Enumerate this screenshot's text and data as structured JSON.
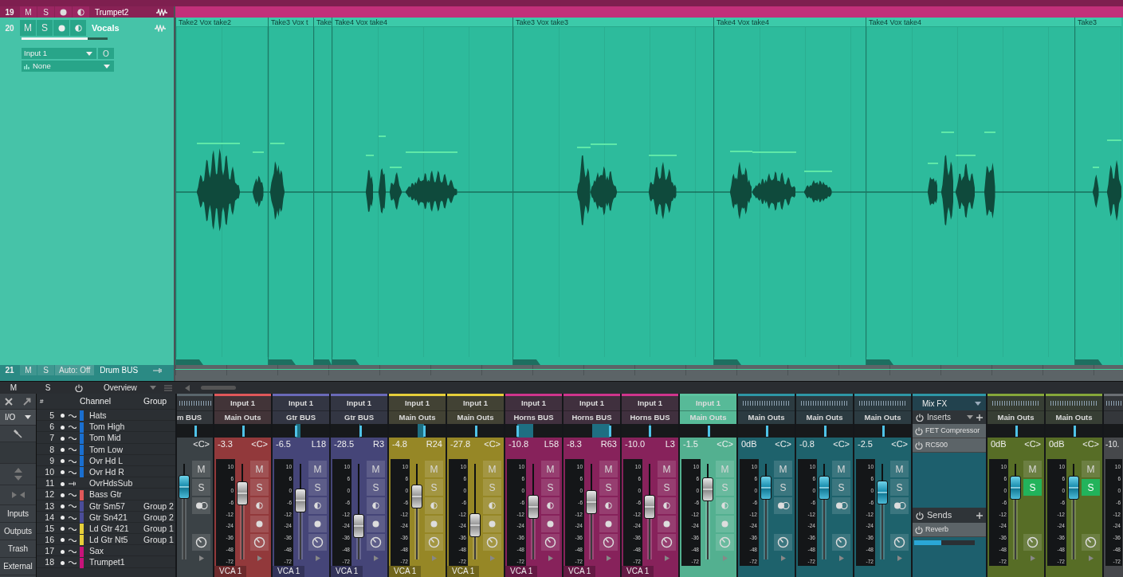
{
  "tracks": [
    {
      "kind": "compact",
      "number": "19",
      "color": "#c2307a",
      "mute": {
        "label": "M",
        "on": false
      },
      "solo": {
        "label": "S",
        "on": false
      },
      "name": "Trumpet2"
    },
    {
      "kind": "expanded",
      "number": "20",
      "color": "#2dbb9c",
      "mute": {
        "label": "M",
        "on": false
      },
      "solo": {
        "label": "S",
        "on": false
      },
      "name": "Vocals",
      "volume": {
        "level": 0.77
      },
      "input": "Input 1",
      "input_button": "O",
      "output": "None",
      "clips": [
        {
          "label": "Take2 Vox take2"
        },
        {
          "label": "Take3 Vox t"
        },
        {
          "label": "Take"
        },
        {
          "label": "Take4 Vox take4"
        },
        {
          "label": "Take3 Vox take3"
        },
        {
          "label": "Take4 Vox take4"
        },
        {
          "label": "Take4 Vox take4"
        },
        {
          "label": "Take3"
        }
      ]
    },
    {
      "kind": "bus",
      "number": "21",
      "color": "#2b8a84",
      "mute": {
        "label": "M",
        "on": false
      },
      "solo": {
        "label": "S",
        "on": false
      },
      "automation": "Auto: Off",
      "name": "Drum BUS"
    }
  ],
  "toolbar": {
    "mute": "M",
    "solo": "S",
    "view": "Overview"
  },
  "mixer": {
    "io_label": "I/O",
    "panels": [
      "Inputs",
      "Outputs",
      "Trash",
      "External"
    ],
    "channel_list": {
      "columns": [
        "#",
        "Channel",
        "Group"
      ],
      "rows": [
        {
          "number": "5",
          "kind": "audio",
          "color": "#1a6fd0",
          "name": "Hats"
        },
        {
          "number": "6",
          "kind": "audio",
          "color": "#1a6fd0",
          "name": "Tom High"
        },
        {
          "number": "7",
          "kind": "audio",
          "color": "#1a6fd0",
          "name": "Tom Mid"
        },
        {
          "number": "8",
          "kind": "audio",
          "color": "#1a6fd0",
          "name": "Tom Low"
        },
        {
          "number": "9",
          "kind": "audio",
          "color": "#1a6fd0",
          "name": "Ovr Hd L"
        },
        {
          "number": "10",
          "kind": "audio",
          "color": "#1a6fd0",
          "name": "Ovr Hd R"
        },
        {
          "number": "11",
          "kind": "bus",
          "name": "OvrHdsSub"
        },
        {
          "number": "12",
          "kind": "audio",
          "color": "#e0585a",
          "name": "Bass Gtr"
        },
        {
          "number": "13",
          "kind": "audio",
          "color": "#4b4d9a",
          "name": "Gtr Sm57",
          "group": "Group 2"
        },
        {
          "number": "14",
          "kind": "audio",
          "color": "#4b4d9a",
          "name": "Gtr Sn421",
          "group": "Group 2"
        },
        {
          "number": "15",
          "kind": "audio",
          "color": "#e6cf3a",
          "name": "Ld Gtr 421",
          "group": "Group 1"
        },
        {
          "number": "16",
          "kind": "audio",
          "color": "#e6cf3a",
          "name": "Ld Gtr Nt5",
          "group": "Group 1"
        },
        {
          "number": "17",
          "kind": "audio",
          "color": "#c8137a",
          "name": "Sax"
        },
        {
          "number": "18",
          "kind": "audio",
          "color": "#c8137a",
          "name": "Trumpet1"
        }
      ]
    },
    "strips": [
      {
        "kind": "bus",
        "color": "#5a666c",
        "selected": false,
        "output": "m BUS",
        "pan": {
          "reading": "<C>",
          "level": 0.5
        },
        "level": 0.76,
        "mute": {
          "label": "M",
          "on": false
        },
        "solo": {
          "label": "S",
          "on": false
        }
      },
      {
        "kind": "audio",
        "color": "#e0585a",
        "selected": false,
        "input": "Input 1",
        "output": "Main Outs",
        "volume": "-3.3",
        "pan": {
          "reading": "<C>",
          "level": 0.5
        },
        "level": 0.69,
        "mute": {
          "label": "M",
          "on": false
        },
        "solo": {
          "label": "S",
          "on": false
        },
        "scale": [
          "10",
          "6",
          "0",
          "-6",
          "-12",
          "-24",
          "-36",
          "-48",
          "-72"
        ],
        "vca": "VCA 1"
      },
      {
        "kind": "audio",
        "color": "#6a6ab8",
        "selected": false,
        "input": "Input 1",
        "output": "Gtr BUS",
        "volume": "-6.5",
        "pan": {
          "reading": "L18",
          "level": 0.41
        },
        "level": 0.62,
        "mute": {
          "label": "M",
          "on": false
        },
        "solo": {
          "label": "S",
          "on": false
        },
        "scale": [
          "10",
          "6",
          "0",
          "-6",
          "-12",
          "-24",
          "-36",
          "-48",
          "-72"
        ],
        "vca": "VCA 1"
      },
      {
        "kind": "audio",
        "color": "#6a6ab8",
        "selected": false,
        "input": "Input 1",
        "output": "Gtr BUS",
        "volume": "-28.5",
        "pan": {
          "reading": "R3",
          "level": 0.52
        },
        "level": 0.35,
        "mute": {
          "label": "M",
          "on": false
        },
        "solo": {
          "label": "S",
          "on": false
        },
        "scale": [
          "10",
          "6",
          "0",
          "-6",
          "-12",
          "-24",
          "-36",
          "-48",
          "-72"
        ],
        "vca": "VCA 1"
      },
      {
        "kind": "audio",
        "color": "#e6cf3a",
        "selected": false,
        "input": "Input 1",
        "output": "Main Outs",
        "volume": "-4.8",
        "pan": {
          "reading": "R24",
          "level": 0.62
        },
        "level": 0.66,
        "mute": {
          "label": "M",
          "on": false
        },
        "solo": {
          "label": "S",
          "on": false
        },
        "scale": [
          "10",
          "6",
          "0",
          "-6",
          "-12",
          "-24",
          "-36",
          "-48",
          "-72"
        ],
        "vca": "VCA 1"
      },
      {
        "kind": "audio",
        "color": "#e6cf3a",
        "selected": false,
        "input": "Input 1",
        "output": "Main Outs",
        "volume": "-27.8",
        "pan": {
          "reading": "<C>",
          "level": 0.5
        },
        "level": 0.36,
        "mute": {
          "label": "M",
          "on": false
        },
        "solo": {
          "label": "S",
          "on": false
        },
        "scale": [
          "10",
          "6",
          "0",
          "-6",
          "-12",
          "-24",
          "-36",
          "-48",
          "-72"
        ],
        "vca": "VCA 1"
      },
      {
        "kind": "audio",
        "color": "#d0358c",
        "selected": false,
        "input": "Input 1",
        "output": "Horns BUS",
        "volume": "-10.8",
        "pan": {
          "reading": "L58",
          "level": 0.21
        },
        "level": 0.55,
        "mute": {
          "label": "M",
          "on": false
        },
        "solo": {
          "label": "S",
          "on": false
        },
        "scale": [
          "10",
          "6",
          "0",
          "-6",
          "-12",
          "-24",
          "-36",
          "-48",
          "-72"
        ],
        "vca": "VCA 1"
      },
      {
        "kind": "audio",
        "color": "#d0358c",
        "selected": false,
        "input": "Input 1",
        "output": "Horns BUS",
        "volume": "-8.3",
        "pan": {
          "reading": "R63",
          "level": 0.82
        },
        "level": 0.6,
        "mute": {
          "label": "M",
          "on": false
        },
        "solo": {
          "label": "S",
          "on": false
        },
        "scale": [
          "10",
          "6",
          "0",
          "-6",
          "-12",
          "-24",
          "-36",
          "-48",
          "-72"
        ],
        "vca": "VCA 1"
      },
      {
        "kind": "audio",
        "color": "#d0358c",
        "selected": false,
        "input": "Input 1",
        "output": "Horns BUS",
        "volume": "-10.0",
        "pan": {
          "reading": "L3",
          "level": 0.49
        },
        "level": 0.55,
        "mute": {
          "label": "M",
          "on": false
        },
        "solo": {
          "label": "S",
          "on": false
        },
        "scale": [
          "10",
          "6",
          "0",
          "-6",
          "-12",
          "-24",
          "-36",
          "-48",
          "-72"
        ],
        "vca": "VCA 1"
      },
      {
        "kind": "audio",
        "color": "#5cc4a0",
        "selected": true,
        "input": "Input 1",
        "output": "Main Outs",
        "volume": "-1.5",
        "pan": {
          "reading": "<C>",
          "level": 0.5
        },
        "level": 0.73,
        "mute": {
          "label": "M",
          "on": false
        },
        "solo": {
          "label": "S",
          "on": false
        },
        "scale": [
          "10",
          "6",
          "0",
          "-6",
          "-12",
          "-24",
          "-36",
          "-48",
          "-72"
        ]
      },
      {
        "kind": "bus",
        "color": "#2e97a6",
        "selected": false,
        "output": "Main Outs",
        "volume": "0dB",
        "pan": {
          "reading": "<C>",
          "level": 0.5
        },
        "level": 0.75,
        "mute": {
          "label": "M",
          "on": false
        },
        "solo": {
          "label": "S",
          "on": false
        },
        "scale": [
          "10",
          "6",
          "0",
          "-6",
          "-12",
          "-24",
          "-36",
          "-48",
          "-72"
        ]
      },
      {
        "kind": "bus",
        "color": "#2e97a6",
        "selected": false,
        "output": "Main Outs",
        "volume": "-0.8",
        "pan": {
          "reading": "<C>",
          "level": 0.5
        },
        "level": 0.75,
        "mute": {
          "label": "M",
          "on": false
        },
        "solo": {
          "label": "S",
          "on": false
        },
        "scale": [
          "10",
          "6",
          "0",
          "-6",
          "-12",
          "-24",
          "-36",
          "-48",
          "-72"
        ]
      },
      {
        "kind": "bus",
        "color": "#2e97a6",
        "selected": false,
        "output": "Main Outs",
        "volume": "-2.5",
        "pan": {
          "reading": "<C>",
          "level": 0.5
        },
        "level": 0.7,
        "mute": {
          "label": "M",
          "on": false
        },
        "solo": {
          "label": "S",
          "on": false
        },
        "scale": [
          "10",
          "6",
          "0",
          "-6",
          "-12",
          "-24",
          "-36",
          "-48",
          "-72"
        ]
      },
      {
        "kind": "mixfx",
        "color": "#2e97a6",
        "title": "Mix FX",
        "inserts": {
          "label": "Inserts",
          "items": [
            "FET Compressor",
            "RC500"
          ]
        },
        "sends": {
          "label": "Sends",
          "items": [
            {
              "name": "Reverb",
              "level": 0.45
            }
          ]
        }
      },
      {
        "kind": "return",
        "color": "#86a83a",
        "selected": false,
        "output": "Main Outs",
        "volume": "0dB",
        "pan": {
          "reading": "<C>",
          "level": 0.5
        },
        "level": 0.75,
        "mute": {
          "label": "M",
          "on": false
        },
        "solo": {
          "label": "S",
          "on": true
        },
        "scale": [
          "10",
          "6",
          "0",
          "-6",
          "-12",
          "-24",
          "-36",
          "-48",
          "-72"
        ]
      },
      {
        "kind": "return",
        "color": "#86a83a",
        "selected": false,
        "output": "Main Outs",
        "volume": "0dB",
        "pan": {
          "reading": "<C>",
          "level": 0.5
        },
        "level": 0.75,
        "mute": {
          "label": "M",
          "on": false
        },
        "solo": {
          "label": "S",
          "on": true
        },
        "scale": [
          "10",
          "6",
          "0",
          "-6",
          "-12",
          "-24",
          "-36",
          "-48",
          "-72"
        ]
      },
      {
        "kind": "bus",
        "color": "#6b6f74",
        "selected": false,
        "volume": "-10.",
        "scale": [
          "10",
          "6",
          "0",
          "-6",
          "-12",
          "-24",
          "-36",
          "-48",
          "-72"
        ]
      }
    ]
  }
}
